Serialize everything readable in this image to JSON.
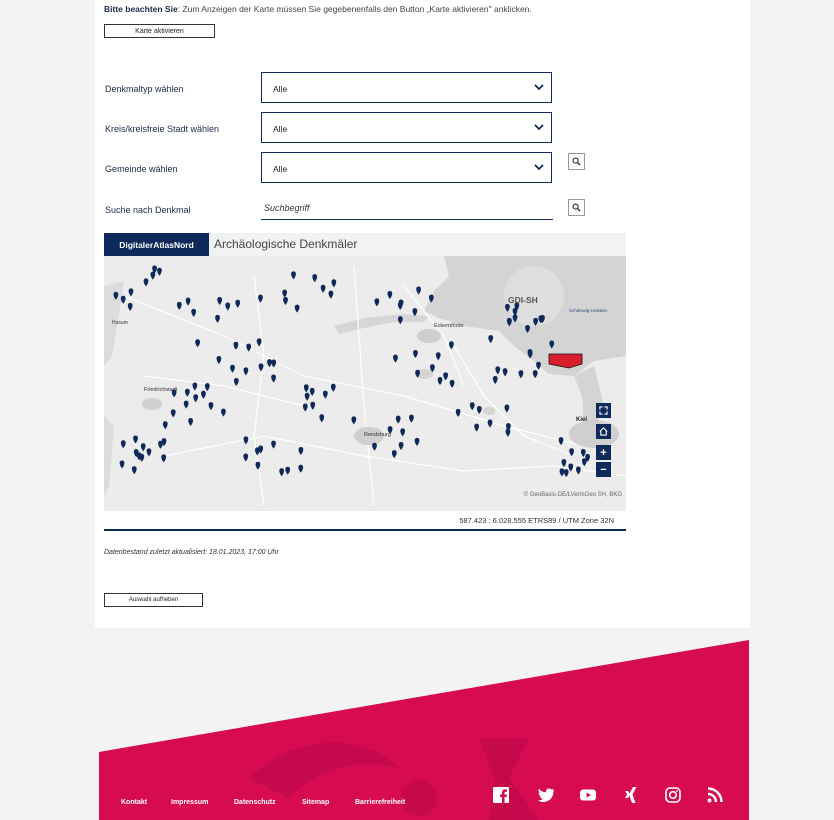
{
  "notice": {
    "bold": "Bitte beachten Sie",
    "text": ": Zum Anzeigen der Karte müssen Sie gegebenenfalls den Button „Karte aktivieren\" anklicken."
  },
  "activate_button": "Karte aktivieren",
  "filters": {
    "type_label": "Denkmaltyp wählen",
    "type_value": "Alle",
    "district_label": "Kreis/kreisfreie Stadt wählen",
    "district_value": "Alle",
    "municipality_label": "Gemeinde wählen",
    "municipality_value": "Alle",
    "search_label": "Suche nach Denkmal",
    "search_placeholder": "Suchbegriff"
  },
  "map": {
    "brand": "DigitalerAtlasNord",
    "title": "Archäologische Denkmäler",
    "coords": "587.423 : 6.028.555  ETRS89 / UTM Zone 32N",
    "attribution": "© GeoBasis-DE/LVermGeo SH, BKG",
    "logo_text": "GDI-SH",
    "places": [
      "Eckernförde",
      "Friedrichstadt",
      "Rendsburg",
      "Kiel",
      "Husum",
      "Schleswig-Holstein"
    ],
    "accent_color": "#0e2a5a",
    "marker_color": "#0e2a5a"
  },
  "updated_text": "Datenbestand zuletzt aktualisiert: 18.01.2023, 17:00 Uhr",
  "reset_button": "Auswahl aufheben",
  "footer": {
    "links": [
      "Kontakt",
      "Impressum",
      "Datenschutz",
      "Sitemap",
      "Barrierefreiheit"
    ],
    "social_icons": [
      "facebook-icon",
      "twitter-icon",
      "youtube-icon",
      "xing-icon",
      "instagram-icon",
      "rss-icon"
    ],
    "color": "#d70b52"
  }
}
